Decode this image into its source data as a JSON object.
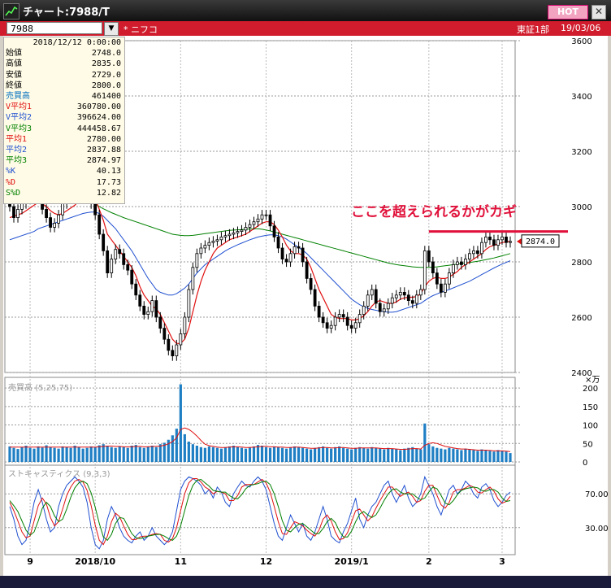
{
  "window": {
    "title": "チャート:7988/T",
    "hot_label": "HOT",
    "close_label": "✕"
  },
  "info": {
    "code": "7988",
    "dropdown": "▼",
    "name": "* ニフコ",
    "market": "東証1部",
    "date": "19/03/06"
  },
  "ohlc_panel": {
    "date": "2018/12/12 0:00:00",
    "rows": [
      {
        "label": "始値",
        "value": "2748.0",
        "color": "#000000"
      },
      {
        "label": "高値",
        "value": "2835.0",
        "color": "#000000"
      },
      {
        "label": "安値",
        "value": "2729.0",
        "color": "#000000"
      },
      {
        "label": "終値",
        "value": "2800.0",
        "color": "#000000"
      },
      {
        "label": "売買高",
        "value": "461400",
        "color": "#0070c0"
      },
      {
        "label": "V平均1",
        "value": "360780.00",
        "color": "#e01010"
      },
      {
        "label": "V平均2",
        "value": "396624.00",
        "color": "#2050d0"
      },
      {
        "label": "V平均3",
        "value": "444458.67",
        "color": "#008000"
      },
      {
        "label": "平均1",
        "value": "2780.00",
        "color": "#e01010"
      },
      {
        "label": "平均2",
        "value": "2837.88",
        "color": "#2050d0"
      },
      {
        "label": "平均3",
        "value": "2874.97",
        "color": "#008000"
      },
      {
        "label": "%K",
        "value": "40.13",
        "color": "#2050d0"
      },
      {
        "label": "%D",
        "value": "17.73",
        "color": "#e01010"
      },
      {
        "label": "S%D",
        "value": "12.82",
        "color": "#008000"
      }
    ]
  },
  "annotation": {
    "text": "ここを超えられるかがカギ",
    "color": "#e0103a",
    "resistance_level": 2910
  },
  "last_price_label": "2874.0",
  "chart_data": [
    {
      "type": "candlestick",
      "panel": "price",
      "ylim": [
        2400,
        3600
      ],
      "y_ticks": [
        "3600",
        "3400",
        "3200",
        "3000",
        "2800",
        "2600",
        "2400"
      ],
      "y_tick_values": [
        3600,
        3400,
        3200,
        3000,
        2800,
        2600,
        2400
      ],
      "x_ticks": [
        "9",
        "2018/10",
        "11",
        "12",
        "2019/1",
        "2",
        "3"
      ],
      "x_tick_index": [
        5,
        21,
        42,
        63,
        84,
        103,
        121
      ],
      "close": [
        3000,
        2960,
        2990,
        3010,
        3030,
        3040,
        3055,
        3060,
        2990,
        2960,
        2925,
        2940,
        2970,
        3010,
        3030,
        3040,
        3060,
        3080,
        3075,
        3040,
        3010,
        2970,
        2900,
        2840,
        2760,
        2810,
        2845,
        2830,
        2790,
        2770,
        2720,
        2680,
        2640,
        2610,
        2620,
        2660,
        2600,
        2560,
        2520,
        2480,
        2460,
        2500,
        2540,
        2600,
        2700,
        2780,
        2830,
        2850,
        2860,
        2870,
        2875,
        2880,
        2890,
        2895,
        2900,
        2905,
        2910,
        2915,
        2925,
        2935,
        2945,
        2955,
        2970,
        2970,
        2930,
        2890,
        2850,
        2810,
        2800,
        2830,
        2855,
        2850,
        2800,
        2740,
        2700,
        2640,
        2600,
        2580,
        2560,
        2570,
        2600,
        2610,
        2600,
        2570,
        2560,
        2580,
        2610,
        2640,
        2680,
        2700,
        2650,
        2620,
        2630,
        2650,
        2670,
        2680,
        2690,
        2680,
        2660,
        2650,
        2680,
        2700,
        2840,
        2800,
        2760,
        2720,
        2690,
        2720,
        2760,
        2790,
        2800,
        2790,
        2810,
        2830,
        2840,
        2830,
        2870,
        2890,
        2880,
        2860,
        2880,
        2890,
        2870,
        2874
      ],
      "ma_short": [
        2960,
        2965,
        2970,
        2975,
        2985,
        2995,
        3005,
        3015,
        3010,
        3000,
        2985,
        2975,
        2970,
        2975,
        2985,
        2995,
        3005,
        3020,
        3035,
        3045,
        3045,
        3030,
        2990,
        2950,
        2900,
        2880,
        2860,
        2840,
        2820,
        2800,
        2780,
        2750,
        2710,
        2680,
        2660,
        2640,
        2630,
        2610,
        2580,
        2550,
        2520,
        2505,
        2505,
        2520,
        2560,
        2620,
        2680,
        2730,
        2770,
        2800,
        2830,
        2850,
        2860,
        2870,
        2880,
        2885,
        2890,
        2895,
        2900,
        2910,
        2920,
        2930,
        2940,
        2945,
        2945,
        2935,
        2915,
        2890,
        2860,
        2840,
        2830,
        2830,
        2825,
        2810,
        2780,
        2740,
        2700,
        2670,
        2640,
        2610,
        2600,
        2595,
        2595,
        2595,
        2590,
        2590,
        2595,
        2605,
        2620,
        2640,
        2655,
        2660,
        2655,
        2650,
        2650,
        2655,
        2665,
        2670,
        2672,
        2672,
        2675,
        2685,
        2710,
        2730,
        2740,
        2745,
        2740,
        2740,
        2745,
        2755,
        2765,
        2780,
        2790,
        2800,
        2810,
        2820,
        2830,
        2845,
        2855,
        2860,
        2865,
        2870,
        2872,
        2875
      ],
      "ma_mid": [
        2880,
        2885,
        2890,
        2895,
        2900,
        2905,
        2910,
        2920,
        2925,
        2930,
        2935,
        2940,
        2945,
        2950,
        2955,
        2960,
        2965,
        2970,
        2975,
        2978,
        2980,
        2980,
        2975,
        2965,
        2950,
        2935,
        2920,
        2900,
        2880,
        2860,
        2840,
        2815,
        2790,
        2765,
        2740,
        2720,
        2700,
        2690,
        2685,
        2680,
        2680,
        2685,
        2695,
        2705,
        2720,
        2740,
        2760,
        2775,
        2790,
        2800,
        2810,
        2820,
        2830,
        2840,
        2848,
        2855,
        2862,
        2868,
        2874,
        2880,
        2885,
        2890,
        2893,
        2896,
        2898,
        2898,
        2895,
        2890,
        2882,
        2872,
        2862,
        2852,
        2842,
        2830,
        2815,
        2800,
        2785,
        2770,
        2755,
        2740,
        2725,
        2710,
        2695,
        2680,
        2665,
        2655,
        2645,
        2638,
        2632,
        2628,
        2625,
        2622,
        2620,
        2618,
        2618,
        2620,
        2625,
        2630,
        2635,
        2640,
        2645,
        2650,
        2660,
        2670,
        2678,
        2684,
        2690,
        2695,
        2700,
        2706,
        2712,
        2718,
        2724,
        2730,
        2738,
        2746,
        2754,
        2762,
        2770,
        2778,
        2785,
        2792,
        2798,
        2804
      ],
      "ma_long": [
        3220,
        3210,
        3200,
        3190,
        3180,
        3170,
        3160,
        3150,
        3140,
        3130,
        3120,
        3110,
        3100,
        3090,
        3080,
        3070,
        3060,
        3050,
        3040,
        3030,
        3020,
        3010,
        3000,
        2992,
        2985,
        2978,
        2972,
        2966,
        2960,
        2955,
        2950,
        2945,
        2940,
        2935,
        2930,
        2925,
        2920,
        2915,
        2910,
        2905,
        2900,
        2898,
        2896,
        2895,
        2895,
        2896,
        2898,
        2900,
        2902,
        2904,
        2906,
        2908,
        2910,
        2912,
        2914,
        2915,
        2916,
        2917,
        2918,
        2919,
        2920,
        2920,
        2918,
        2915,
        2912,
        2908,
        2904,
        2900,
        2896,
        2892,
        2888,
        2884,
        2880,
        2876,
        2872,
        2868,
        2864,
        2860,
        2856,
        2852,
        2848,
        2844,
        2840,
        2836,
        2832,
        2828,
        2824,
        2820,
        2816,
        2812,
        2808,
        2804,
        2800,
        2796,
        2793,
        2790,
        2788,
        2786,
        2784,
        2782,
        2781,
        2780,
        2780,
        2780,
        2781,
        2782,
        2784,
        2786,
        2788,
        2790,
        2792,
        2794,
        2796,
        2798,
        2800,
        2802,
        2805,
        2808,
        2811,
        2814,
        2818,
        2822,
        2826,
        2830
      ]
    },
    {
      "type": "bar",
      "panel": "volume",
      "title": "売買高 (5,25,75)",
      "unit": "×万",
      "ylim": [
        0,
        220
      ],
      "y_ticks": [
        "200",
        "150",
        "100",
        "50",
        "0"
      ],
      "y_tick_values": [
        200,
        150,
        100,
        50,
        0
      ],
      "values": [
        42,
        38,
        35,
        40,
        44,
        38,
        36,
        42,
        39,
        45,
        40,
        38,
        36,
        42,
        40,
        38,
        44,
        40,
        36,
        38,
        42,
        40,
        45,
        48,
        44,
        40,
        38,
        42,
        40,
        38,
        44,
        46,
        40,
        38,
        42,
        44,
        40,
        48,
        52,
        60,
        72,
        90,
        210,
        75,
        55,
        48,
        44,
        40,
        38,
        42,
        40,
        38,
        36,
        40,
        42,
        44,
        40,
        38,
        36,
        40,
        42,
        46,
        44,
        40,
        38,
        42,
        40,
        38,
        36,
        40,
        42,
        40,
        38,
        36,
        34,
        38,
        40,
        42,
        38,
        36,
        40,
        42,
        38,
        36,
        34,
        38,
        40,
        38,
        36,
        40,
        38,
        36,
        34,
        38,
        36,
        34,
        32,
        36,
        38,
        40,
        36,
        34,
        104,
        48,
        42,
        38,
        36,
        34,
        38,
        36,
        34,
        32,
        36,
        34,
        32,
        30,
        34,
        32,
        30,
        28,
        32,
        30,
        28,
        24
      ],
      "ma_values": [
        40,
        40,
        40,
        40,
        40,
        40,
        40,
        40,
        40,
        40,
        40,
        40,
        40,
        40,
        40,
        40,
        40,
        40,
        40,
        40,
        40,
        40,
        41,
        42,
        43,
        43,
        42,
        42,
        41,
        41,
        41,
        42,
        42,
        41,
        41,
        42,
        42,
        43,
        45,
        49,
        55,
        65,
        88,
        92,
        88,
        80,
        70,
        58,
        48,
        44,
        42,
        40,
        39,
        39,
        40,
        41,
        41,
        40,
        39,
        39,
        40,
        41,
        42,
        42,
        41,
        41,
        40,
        40,
        39,
        39,
        40,
        40,
        39,
        38,
        37,
        37,
        38,
        39,
        39,
        38,
        38,
        39,
        39,
        38,
        37,
        37,
        38,
        38,
        38,
        38,
        38,
        37,
        36,
        36,
        36,
        35,
        34,
        34,
        35,
        36,
        36,
        35,
        45,
        50,
        52,
        50,
        46,
        42,
        40,
        38,
        36,
        35,
        35,
        34,
        33,
        32,
        32,
        32,
        31,
        30,
        30,
        30,
        29,
        28
      ]
    },
    {
      "type": "line",
      "panel": "stochastics",
      "title": "ストキャスティクス (9,3,3)",
      "ylim": [
        0,
        100
      ],
      "y_ticks": [
        "70.00",
        "30.00"
      ],
      "y_tick_values": [
        70,
        30
      ],
      "series": [
        {
          "name": "%K",
          "color": "#2050d0",
          "values": [
            55,
            40,
            20,
            10,
            15,
            35,
            60,
            75,
            60,
            40,
            25,
            30,
            55,
            70,
            80,
            85,
            90,
            85,
            78,
            60,
            30,
            10,
            5,
            15,
            40,
            55,
            45,
            30,
            20,
            15,
            12,
            20,
            25,
            15,
            20,
            30,
            20,
            15,
            10,
            15,
            25,
            50,
            75,
            85,
            90,
            88,
            85,
            80,
            70,
            75,
            65,
            78,
            72,
            60,
            55,
            70,
            78,
            85,
            80,
            78,
            85,
            90,
            85,
            75,
            55,
            35,
            20,
            15,
            30,
            45,
            35,
            25,
            35,
            20,
            15,
            25,
            40,
            55,
            40,
            20,
            15,
            12,
            25,
            35,
            50,
            65,
            40,
            30,
            45,
            55,
            60,
            70,
            80,
            85,
            70,
            60,
            70,
            80,
            65,
            55,
            60,
            70,
            90,
            80,
            70,
            55,
            45,
            60,
            75,
            80,
            70,
            75,
            85,
            80,
            70,
            65,
            78,
            82,
            75,
            62,
            55,
            60,
            68,
            72
          ]
        },
        {
          "name": "%D",
          "color": "#e01010",
          "values": [
            60,
            50,
            38,
            25,
            18,
            20,
            38,
            56,
            65,
            58,
            42,
            32,
            37,
            52,
            68,
            78,
            85,
            87,
            84,
            74,
            56,
            33,
            15,
            10,
            20,
            37,
            47,
            43,
            32,
            22,
            16,
            16,
            19,
            20,
            20,
            22,
            23,
            22,
            15,
            13,
            17,
            30,
            50,
            70,
            83,
            88,
            88,
            84,
            78,
            75,
            70,
            73,
            72,
            70,
            62,
            62,
            68,
            78,
            81,
            81,
            81,
            84,
            87,
            83,
            72,
            55,
            37,
            23,
            22,
            30,
            37,
            35,
            32,
            27,
            23,
            20,
            27,
            40,
            45,
            38,
            25,
            16,
            17,
            24,
            37,
            50,
            52,
            45,
            38,
            43,
            53,
            62,
            70,
            78,
            78,
            72,
            67,
            70,
            72,
            67,
            60,
            62,
            73,
            80,
            80,
            68,
            57,
            53,
            60,
            72,
            75,
            75,
            77,
            80,
            78,
            72,
            71,
            75,
            78,
            73,
            64,
            59,
            61,
            67
          ]
        },
        {
          "name": "S%D",
          "color": "#008000",
          "values": [
            62,
            56,
            49,
            38,
            27,
            21,
            25,
            38,
            53,
            60,
            55,
            44,
            37,
            40,
            52,
            66,
            77,
            83,
            85,
            82,
            71,
            54,
            35,
            19,
            15,
            22,
            35,
            42,
            41,
            32,
            23,
            18,
            17,
            18,
            20,
            21,
            22,
            22,
            20,
            17,
            15,
            20,
            32,
            50,
            68,
            80,
            86,
            87,
            83,
            79,
            74,
            73,
            72,
            72,
            68,
            65,
            64,
            69,
            76,
            80,
            81,
            82,
            84,
            85,
            81,
            70,
            55,
            38,
            27,
            25,
            30,
            34,
            35,
            31,
            27,
            23,
            23,
            29,
            37,
            41,
            36,
            26,
            19,
            19,
            26,
            37,
            46,
            49,
            45,
            42,
            45,
            53,
            62,
            70,
            75,
            76,
            72,
            70,
            70,
            70,
            66,
            63,
            65,
            72,
            78,
            76,
            68,
            59,
            57,
            62,
            69,
            74,
            76,
            77,
            78,
            77,
            74,
            73,
            75,
            75,
            72,
            65,
            61,
            62
          ]
        }
      ]
    }
  ]
}
